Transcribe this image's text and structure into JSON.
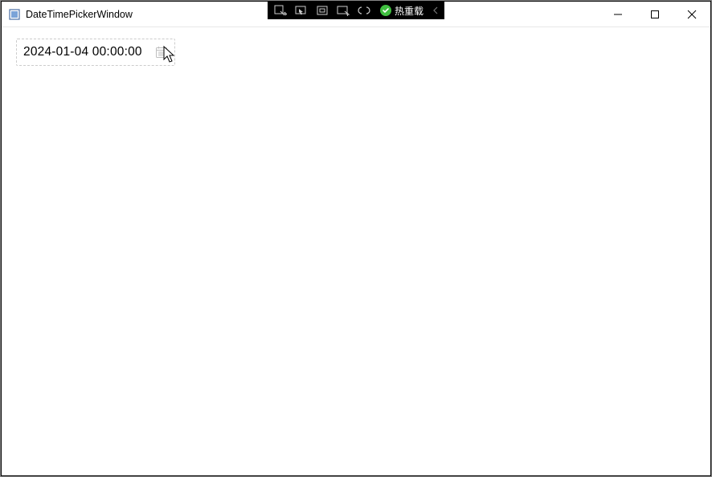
{
  "window": {
    "title": "DateTimePickerWindow"
  },
  "debugbar": {
    "hot_reload_label": "热重载"
  },
  "picker": {
    "value": "2024-01-04 00:00:00"
  }
}
